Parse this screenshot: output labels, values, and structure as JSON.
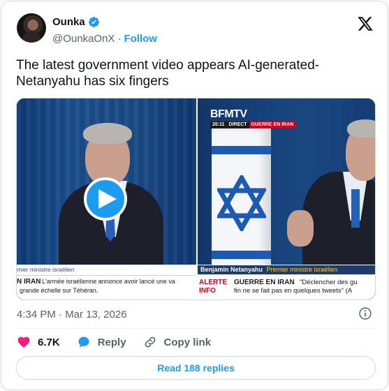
{
  "author": {
    "name": "Ounka",
    "handle": "@OunkaOnX",
    "separator": "·",
    "follow_label": "Follow",
    "verified": true
  },
  "tweet": {
    "text": "The latest government video appears AI-generated-\nNetanyahu has six fingers"
  },
  "media": {
    "left_frame": {
      "lower_third_name": "mier ministre israélien",
      "ticker_label": "N IRAN",
      "ticker_line1": "L'armée israélienne annonce avoir lancé une va",
      "ticker_line2": "grande échelle sur Téhéran."
    },
    "right_frame": {
      "channel": "BFMTV",
      "time": "20:11",
      "live": "DIRECT",
      "topic": "GUERRE EN IRAN",
      "lower_third_name": "Benjamin Netanyahu",
      "lower_third_role": "Premier ministre israélien",
      "alert_line1": "ALERTE",
      "alert_line2": "INFO",
      "headline": "GUERRE EN IRAN",
      "quote_line1": "\"Déclencher des gu",
      "quote_line2": "fin ne se fait pas en quelques tweets\" (A"
    },
    "play_icon": "play-icon"
  },
  "meta": {
    "timestamp": "4:34 PM · Mar 13, 2026"
  },
  "actions": {
    "likes_count": "6.7K",
    "reply_label": "Reply",
    "copy_link_label": "Copy link"
  },
  "replies_button": "Read 188 replies",
  "colors": {
    "accent": "#1d9bf0",
    "like": "#f91880",
    "text": "#0f1419",
    "muted": "#536471",
    "border": "#cfd9de"
  }
}
